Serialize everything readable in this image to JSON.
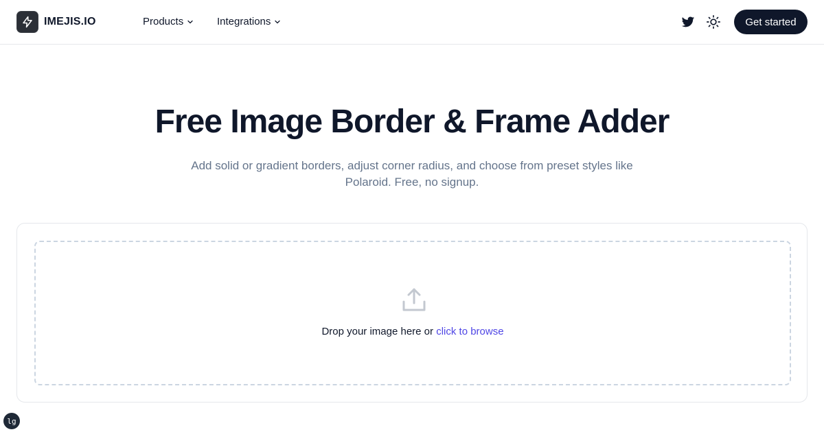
{
  "header": {
    "brand": "IMEJIS.IO",
    "nav": [
      {
        "label": "Products"
      },
      {
        "label": "Integrations"
      }
    ],
    "cta_label": "Get started",
    "icons": [
      "bolt-icon",
      "chevron-down-icon",
      "twitter-icon",
      "sun-icon"
    ]
  },
  "hero": {
    "title": "Free Image Border & Frame Adder",
    "subtitle": "Add solid or gradient borders, adjust corner radius, and choose from preset styles like Polaroid. Free, no signup."
  },
  "upload": {
    "text": "Drop your image here or",
    "link": "click to browse",
    "icon": "upload-icon"
  },
  "badge": {
    "label": "lg"
  },
  "colors": {
    "primary": "#0f172a",
    "link": "#4f46e5",
    "muted": "#64748b",
    "border": "#e5e7eb"
  }
}
